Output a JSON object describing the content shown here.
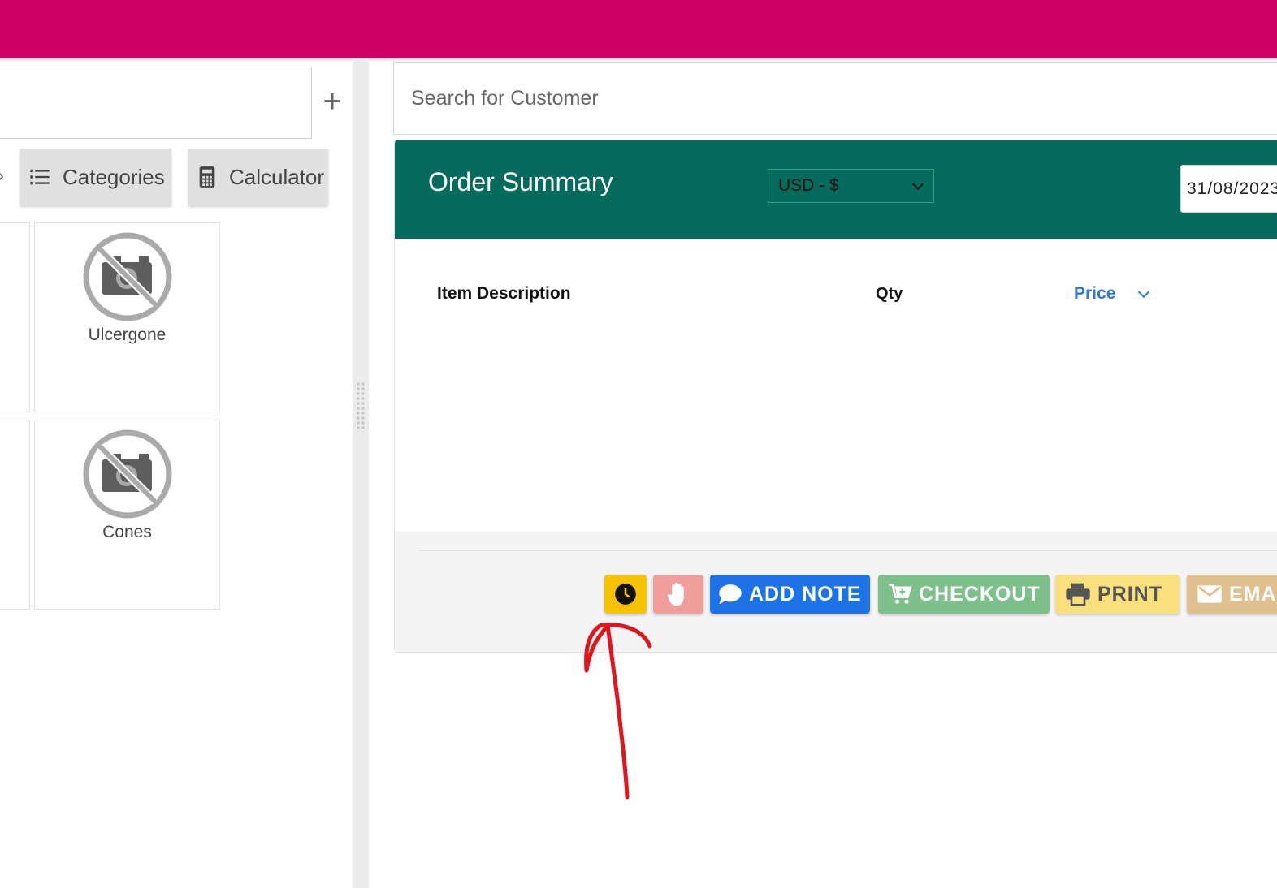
{
  "colors": {
    "topbar": "#cf0063",
    "order_header": "#066b5c",
    "clock_button": "#f7c300",
    "hold_button": "#f09e9b",
    "note_button": "#1d73e5",
    "checkout_button": "#7dc08b",
    "print_button": "#fae07d",
    "email_button": "#e0c08e",
    "price_header": "#2f78d8",
    "annotation": "#e0161e"
  },
  "left": {
    "add_label": "+",
    "tabs": [
      {
        "label": "Categories",
        "icon": "list-icon"
      },
      {
        "label": "Calculator",
        "icon": "calculator-icon"
      }
    ],
    "products": [
      {
        "name": "Ulcergone",
        "icon": "no-image-icon"
      },
      {
        "name": "Cones",
        "icon": "no-image-icon"
      }
    ]
  },
  "right": {
    "customer_search": {
      "placeholder": "Search for Customer"
    },
    "order": {
      "title": "Order Summary",
      "currency": "USD - $",
      "date": "31/08/2023",
      "columns": {
        "description": "Item Description",
        "qty": "Qty",
        "price": "Price"
      }
    },
    "actions": [
      {
        "label": "",
        "icon": "clock-icon"
      },
      {
        "label": "",
        "icon": "hand-icon"
      },
      {
        "label": "ADD NOTE",
        "icon": "comment-icon"
      },
      {
        "label": "CHECKOUT",
        "icon": "cart-plus-icon"
      },
      {
        "label": "PRINT",
        "icon": "printer-icon"
      },
      {
        "label": "EMAIL",
        "icon": "envelope-icon"
      }
    ]
  }
}
